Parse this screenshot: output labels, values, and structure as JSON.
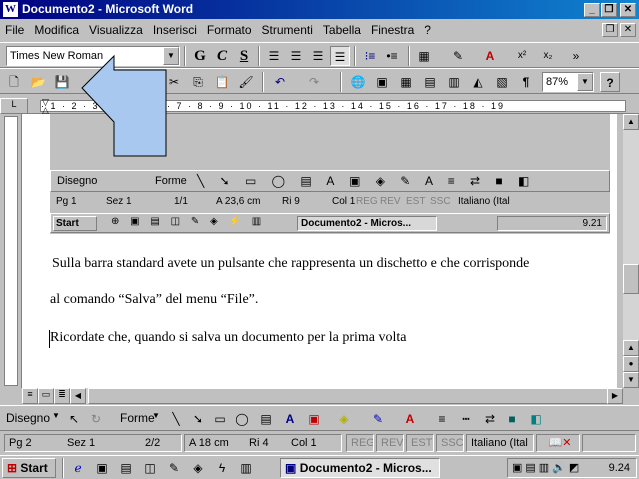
{
  "window": {
    "title": "Documento2 - Microsoft Word",
    "app_icon": "W"
  },
  "menu": [
    "File",
    "Modifica",
    "Visualizza",
    "Inserisci",
    "Formato",
    "Strumenti",
    "Tabella",
    "Finestra",
    "?"
  ],
  "format_toolbar": {
    "font_name": "Times New Roman",
    "bold": "G",
    "italic": "C",
    "underline": "S",
    "superscript": "x²",
    "subscript": "x₂"
  },
  "standard_toolbar": {
    "zoom": "87%",
    "help": "?"
  },
  "document": {
    "line1": " Sulla barra standard avete un pulsante che rappresenta un dischetto e che corrisponde",
    "line2": "al comando “Salva” del menu “File”.",
    "line3": "Ricordate che, quando si salva un documento per la prima volta"
  },
  "drawing_toolbar": {
    "draw_label": "Disegno",
    "shapes_label": "Forme"
  },
  "status": {
    "page": "Pg 2",
    "section": "Sez 1",
    "pages": "2/2",
    "at": "A  18 cm",
    "line": "Ri  4",
    "col": "Col  1",
    "reg": "REG",
    "rev": "REV",
    "est": "EST",
    "ssc": "SSC",
    "lang": "Italiano (Ital"
  },
  "taskbar": {
    "start": "Start",
    "task": "Documento2 - Micros...",
    "clock": "9.24"
  },
  "nested": {
    "draw_label": "Disegno",
    "shapes_label": "Forme",
    "status": {
      "page": "Pg  1",
      "section": "Sez  1",
      "pages": "1/1",
      "at": "A  23,6 cm",
      "line": "Ri  9",
      "col": "Col  1",
      "reg": "REG",
      "rev": "REV",
      "est": "EST",
      "ssc": "SSC",
      "lang": "Italiano (Ital"
    },
    "taskbar": {
      "start": "Start",
      "task": "Documento2 - Micros...",
      "clock": "9.21"
    }
  },
  "colors": {
    "title_start": "#000080",
    "title_end": "#1084d0",
    "callout": "#a8c8f0"
  }
}
